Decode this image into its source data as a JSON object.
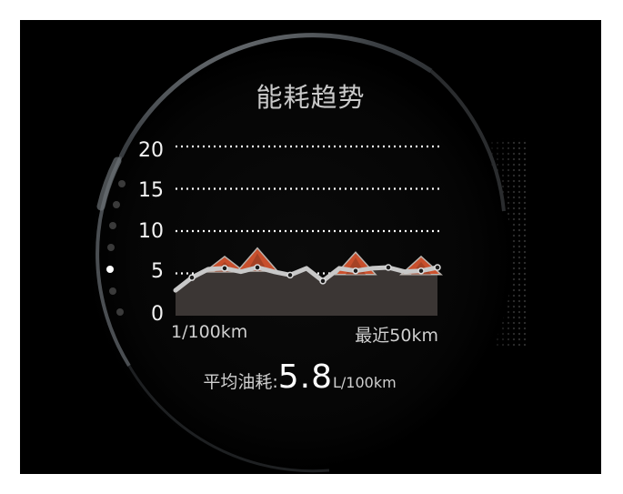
{
  "screen_title": "能耗趋势",
  "average": {
    "label": "平均油耗:",
    "value": "5.8",
    "unit": "L/100km"
  },
  "page_dots": {
    "count": 7,
    "active_index": 4
  },
  "chart_data": {
    "type": "area",
    "title": "能耗趋势",
    "ylim": [
      0,
      20
    ],
    "yticks": [
      "20",
      "15",
      "10",
      "5",
      "0"
    ],
    "ylabel": "1/100km",
    "x_end_label": "最近50km",
    "gridlines": [
      5,
      10,
      15,
      20
    ],
    "grid_style": "dotted",
    "series": [
      {
        "values": [
          3.0,
          4.5,
          5.5,
          5.6,
          5.2,
          5.7,
          5.2,
          4.8,
          5.6,
          4.1,
          5.6,
          5.3,
          5.6,
          5.7,
          5.2,
          5.3,
          5.7
        ]
      }
    ],
    "peak_markers": [
      {
        "x_index": 3,
        "value": 7.0
      },
      {
        "x_index": 5,
        "value": 8.0
      },
      {
        "x_index": 11,
        "value": 7.5
      },
      {
        "x_index": 15,
        "value": 7.0
      }
    ],
    "colors": {
      "area": "#3b3634",
      "line": "#c8c8c8",
      "peak": "#d9552f",
      "grid": "#ffffff"
    }
  }
}
